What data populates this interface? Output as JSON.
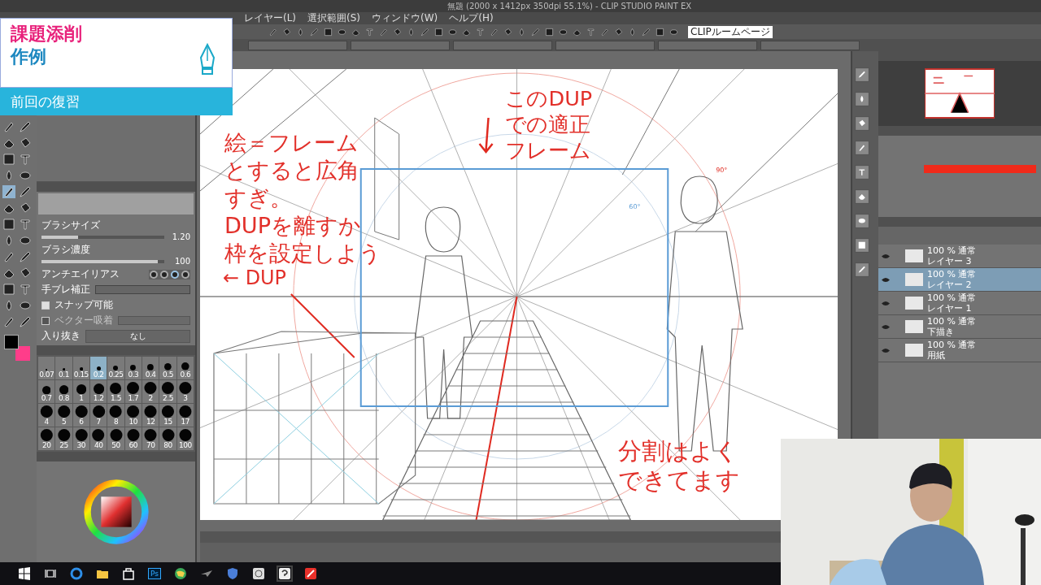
{
  "window": {
    "title": "無題 (2000 x 1412px 350dpi 55.1%) - CLIP STUDIO PAINT EX"
  },
  "menu": [
    "レイヤー(L)",
    "選択範囲(S)",
    "ウィンドウ(W)",
    "ヘルプ(H)"
  ],
  "command_bar": {
    "link": "CLIPルームページ"
  },
  "overlay": {
    "title": "課題添削",
    "subtitle": "作例",
    "section": "前回の復習"
  },
  "tool_property": [
    {
      "kind": "slider",
      "label": "ブラシサイズ",
      "value": "1.20",
      "level": 0.3
    },
    {
      "kind": "slider",
      "label": "ブラシ濃度",
      "value": "100",
      "level": 0.95
    },
    {
      "kind": "shapes",
      "label": "アンチエイリアス"
    },
    {
      "kind": "field",
      "label": "手ブレ補正"
    },
    {
      "kind": "check",
      "label": "スナップ可能",
      "checked": true
    },
    {
      "kind": "segments",
      "label": "ベクター吸着",
      "checked": false
    },
    {
      "kind": "select",
      "label": "入り抜き",
      "value": "なし"
    }
  ],
  "brush_sizes": [
    {
      "label": "0.07",
      "selected": false
    },
    {
      "label": "0.1",
      "selected": false
    },
    {
      "label": "0.15",
      "selected": false
    },
    {
      "label": "0.2",
      "selected": true
    },
    {
      "label": "0.25",
      "selected": false
    },
    {
      "label": "0.3",
      "selected": false
    },
    {
      "label": "0.4",
      "selected": false
    },
    {
      "label": "0.5",
      "selected": false
    },
    {
      "label": "0.6",
      "selected": false
    },
    {
      "label": "0.7",
      "selected": false
    },
    {
      "label": "0.8",
      "selected": false
    },
    {
      "label": "1",
      "selected": false
    },
    {
      "label": "1.2",
      "selected": false
    },
    {
      "label": "1.5",
      "selected": false
    },
    {
      "label": "1.7",
      "selected": false
    },
    {
      "label": "2",
      "selected": false
    },
    {
      "label": "2.5",
      "selected": false
    },
    {
      "label": "3",
      "selected": false
    },
    {
      "label": "4",
      "selected": false
    },
    {
      "label": "5",
      "selected": false
    },
    {
      "label": "6",
      "selected": false
    },
    {
      "label": "7",
      "selected": false
    },
    {
      "label": "8",
      "selected": false
    },
    {
      "label": "10",
      "selected": false
    },
    {
      "label": "12",
      "selected": false
    },
    {
      "label": "15",
      "selected": false
    },
    {
      "label": "17",
      "selected": false
    },
    {
      "label": "20",
      "selected": false
    },
    {
      "label": "25",
      "selected": false
    },
    {
      "label": "30",
      "selected": false
    },
    {
      "label": "40",
      "selected": false
    },
    {
      "label": "50",
      "selected": false
    },
    {
      "label": "60",
      "selected": false
    },
    {
      "label": "70",
      "selected": false
    },
    {
      "label": "80",
      "selected": false
    },
    {
      "label": "100",
      "selected": false
    }
  ],
  "canvas": {
    "notes": [
      {
        "lines": [
          "絵＝フレーム",
          "とすると広角",
          "すぎ。",
          "DUPを離すか",
          "枠を設定しよう"
        ]
      },
      {
        "lines": [
          "← DUP"
        ]
      },
      {
        "lines": [
          "このDUP",
          "での適正",
          "フレーム"
        ]
      },
      {
        "lines": [
          "分割はよく",
          "できてます"
        ]
      }
    ],
    "angle_labels": [
      "90°",
      "60°"
    ]
  },
  "layers": [
    {
      "mode": "100 % 通常",
      "name": "レイヤー 3",
      "selected": false
    },
    {
      "mode": "100 % 通常",
      "name": "レイヤー 2",
      "selected": true
    },
    {
      "mode": "100 % 通常",
      "name": "レイヤー 1",
      "selected": false
    },
    {
      "mode": "100 % 通常",
      "name": "下描き",
      "selected": false
    },
    {
      "mode": "100 % 通常",
      "name": "用紙",
      "selected": false
    }
  ],
  "taskbar": [
    {
      "kind": "start"
    },
    {
      "kind": "taskview"
    },
    {
      "kind": "browser"
    },
    {
      "kind": "folder"
    },
    {
      "kind": "store"
    },
    {
      "kind": "ps",
      "label": "Ps"
    },
    {
      "kind": "map"
    },
    {
      "kind": "plane"
    },
    {
      "kind": "shield"
    },
    {
      "kind": "disc"
    },
    {
      "kind": "clip"
    },
    {
      "kind": "paint"
    }
  ]
}
